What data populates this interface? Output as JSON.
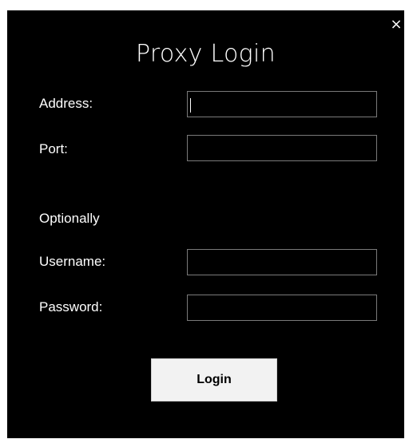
{
  "dialog": {
    "title": "Proxy Login",
    "close_glyph": "×",
    "background_color": "#000000",
    "text_color": "#ffffff"
  },
  "form": {
    "address": {
      "label": "Address:",
      "value": "",
      "placeholder": ""
    },
    "port": {
      "label": "Port:",
      "value": "",
      "placeholder": ""
    },
    "optional_heading": "Optionally",
    "username": {
      "label": "Username:",
      "value": "",
      "placeholder": ""
    },
    "password": {
      "label": "Password:",
      "value": "",
      "placeholder": ""
    }
  },
  "actions": {
    "login_label": "Login"
  }
}
